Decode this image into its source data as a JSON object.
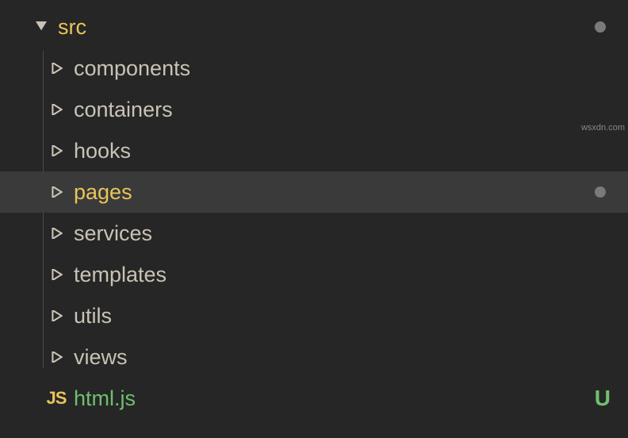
{
  "tree": {
    "root": {
      "label": "src",
      "expanded": true,
      "modified": true
    },
    "children": [
      {
        "label": "components",
        "expanded": false
      },
      {
        "label": "containers",
        "expanded": false
      },
      {
        "label": "hooks",
        "expanded": false
      },
      {
        "label": "pages",
        "expanded": false,
        "selected": true,
        "modified": true
      },
      {
        "label": "services",
        "expanded": false
      },
      {
        "label": "templates",
        "expanded": false
      },
      {
        "label": "utils",
        "expanded": false
      },
      {
        "label": "views",
        "expanded": false
      }
    ],
    "file": {
      "label": "html.js",
      "iconText": "JS",
      "status": "U"
    }
  },
  "watermark": "wsxdn.com"
}
